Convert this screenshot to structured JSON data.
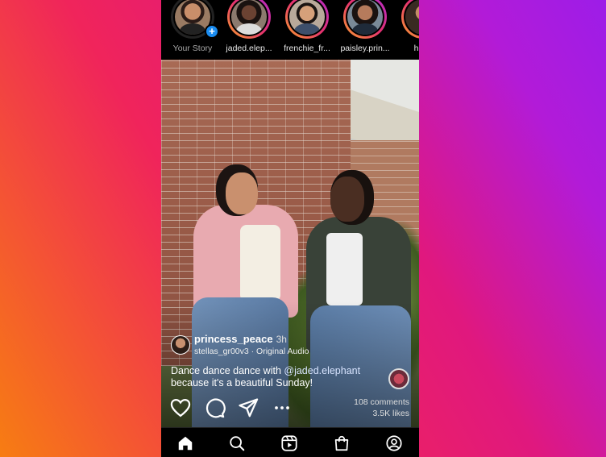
{
  "stories": [
    {
      "label": "Your Story",
      "own": true,
      "add_icon": "plus-icon"
    },
    {
      "label": "jaded.elep..."
    },
    {
      "label": "frenchie_fr..."
    },
    {
      "label": "paisley.prin..."
    },
    {
      "label": "heav"
    }
  ],
  "post": {
    "author": "princess_peace",
    "time": "3h",
    "audio": "stellas_gr00v3 · Original Audio",
    "caption_pre": "Dance dance dance with ",
    "caption_mention": "@jaded.elephant",
    "caption_post": " because it's a beautiful Sunday!",
    "comments": "108 comments",
    "likes": "3.5K likes"
  },
  "actions": [
    "heart-icon",
    "comment-icon",
    "share-icon",
    "more-icon"
  ],
  "bottom_nav": [
    "home-icon",
    "search-icon",
    "reels-icon",
    "shop-icon",
    "profile-icon"
  ],
  "colors": {
    "accent": "#1a8cf0",
    "ring_start": "#f9a12e",
    "ring_end": "#b02bd1"
  }
}
